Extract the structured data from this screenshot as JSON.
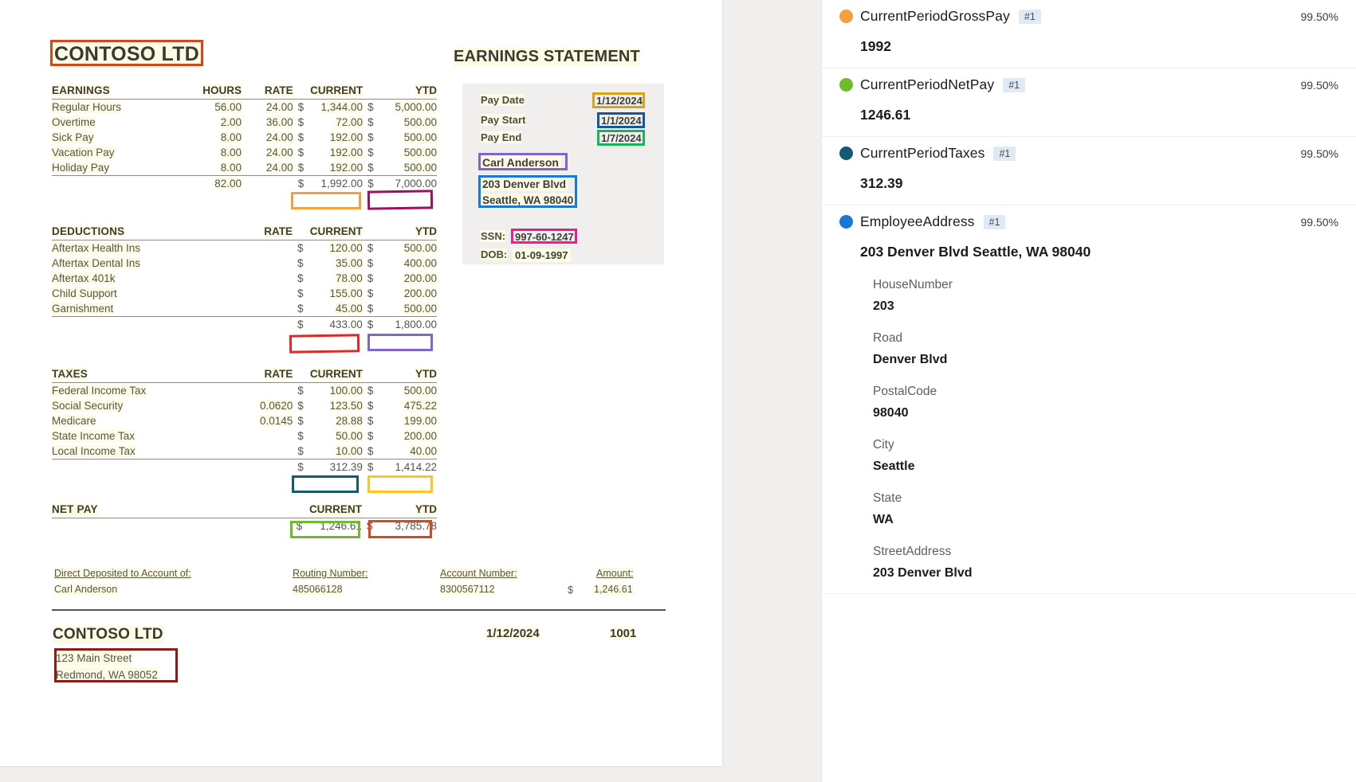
{
  "document": {
    "company_title": "CONTOSO LTD",
    "statement_title": "EARNINGS STATEMENT",
    "earnings": {
      "headers": [
        "EARNINGS",
        "HOURS",
        "RATE",
        "CURRENT",
        "YTD"
      ],
      "rows": [
        {
          "label": "Regular Hours",
          "hours": "56.00",
          "rate": "24.00",
          "current": "1,344.00",
          "ytd": "5,000.00"
        },
        {
          "label": "Overtime",
          "hours": "2.00",
          "rate": "36.00",
          "current": "72.00",
          "ytd": "500.00"
        },
        {
          "label": "Sick Pay",
          "hours": "8.00",
          "rate": "24.00",
          "current": "192.00",
          "ytd": "500.00"
        },
        {
          "label": "Vacation Pay",
          "hours": "8.00",
          "rate": "24.00",
          "current": "192.00",
          "ytd": "500.00"
        },
        {
          "label": "Holiday Pay",
          "hours": "8.00",
          "rate": "24.00",
          "current": "192.00",
          "ytd": "500.00"
        }
      ],
      "total": {
        "hours": "82.00",
        "current": "1,992.00",
        "ytd": "7,000.00"
      }
    },
    "deductions": {
      "headers": [
        "DEDUCTIONS",
        "RATE",
        "CURRENT",
        "YTD"
      ],
      "rows": [
        {
          "label": "Aftertax Health Ins",
          "rate": "",
          "current": "120.00",
          "ytd": "500.00"
        },
        {
          "label": "Aftertax Dental Ins",
          "rate": "",
          "current": "35.00",
          "ytd": "400.00"
        },
        {
          "label": "Aftertax 401k",
          "rate": "",
          "current": "78.00",
          "ytd": "200.00"
        },
        {
          "label": "Child Support",
          "rate": "",
          "current": "155.00",
          "ytd": "200.00"
        },
        {
          "label": "Garnishment",
          "rate": "",
          "current": "45.00",
          "ytd": "500.00"
        }
      ],
      "total": {
        "current": "433.00",
        "ytd": "1,800.00"
      }
    },
    "taxes": {
      "headers": [
        "TAXES",
        "RATE",
        "CURRENT",
        "YTD"
      ],
      "rows": [
        {
          "label": "Federal Income Tax",
          "rate": "",
          "current": "100.00",
          "ytd": "500.00"
        },
        {
          "label": "Social Security",
          "rate": "0.0620",
          "current": "123.50",
          "ytd": "475.22"
        },
        {
          "label": "Medicare",
          "rate": "0.0145",
          "current": "28.88",
          "ytd": "199.00"
        },
        {
          "label": "State Income Tax",
          "rate": "",
          "current": "50.00",
          "ytd": "200.00"
        },
        {
          "label": "Local Income Tax",
          "rate": "",
          "current": "10.00",
          "ytd": "40.00"
        }
      ],
      "total": {
        "current": "312.39",
        "ytd": "1,414.22"
      }
    },
    "netpay": {
      "headers": [
        "NET PAY",
        "CURRENT",
        "YTD"
      ],
      "total": {
        "current": "1,246.61",
        "ytd": "3,785.78"
      }
    },
    "statement": {
      "pay_date_label": "Pay Date",
      "pay_date_value": "1/12/2024",
      "pay_start_label": "Pay Start",
      "pay_start_value": "1/1/2024",
      "pay_end_label": "Pay End",
      "pay_end_value": "1/7/2024",
      "employee_name": "Carl Anderson",
      "address_line1": "203 Denver Blvd",
      "address_line2": "Seattle, WA 98040",
      "ssn_label": "SSN:",
      "ssn_value": "997-60-1247",
      "dob_label": "DOB:",
      "dob_value": "01-09-1997"
    },
    "deposit": {
      "account_of_label": "Direct Deposited to Account of:",
      "account_of_value": "Carl Anderson",
      "routing_label": "Routing Number:",
      "routing_value": "485066128",
      "account_label": "Account Number:",
      "account_value": "8300567112",
      "amount_label": "Amount:",
      "amount_currency": "$",
      "amount_value": "1,246.61"
    },
    "footer": {
      "company": "CONTOSO LTD",
      "date": "1/12/2024",
      "check_number": "1001",
      "address_line1": "123 Main Street",
      "address_line2": "Redmond, WA 98052"
    },
    "currency_symbol": "$"
  },
  "annotations": [
    {
      "name": "company-title",
      "color": "#d1481f"
    },
    {
      "name": "gross-current",
      "color": "#f5a03c"
    },
    {
      "name": "gross-ytd",
      "color": "#9c1160"
    },
    {
      "name": "deduct-current",
      "color": "#dc2a27"
    },
    {
      "name": "deduct-ytd",
      "color": "#8166c8"
    },
    {
      "name": "taxes-current",
      "color": "#135a72"
    },
    {
      "name": "taxes-ytd",
      "color": "#fcc51f"
    },
    {
      "name": "net-current",
      "color": "#6fbb2d"
    },
    {
      "name": "net-ytd",
      "color": "#e24618"
    },
    {
      "name": "pay-date",
      "color": "#d6a419"
    },
    {
      "name": "pay-start",
      "color": "#1257a0"
    },
    {
      "name": "pay-end",
      "color": "#17b45e"
    },
    {
      "name": "employee-name",
      "color": "#8166c8"
    },
    {
      "name": "employee-address",
      "color": "#1879d2"
    },
    {
      "name": "ssn",
      "color": "#ec1d8e"
    },
    {
      "name": "employer-address",
      "color": "#8d1c18"
    }
  ],
  "panel": {
    "fields": [
      {
        "name": "CurrentPeriodGrossPay",
        "index": "#1",
        "confidence": "99.50%",
        "color": "#f5a03c",
        "value": "1992",
        "subfields": []
      },
      {
        "name": "CurrentPeriodNetPay",
        "index": "#1",
        "confidence": "99.50%",
        "color": "#6fbb2d",
        "value": "1246.61",
        "subfields": []
      },
      {
        "name": "CurrentPeriodTaxes",
        "index": "#1",
        "confidence": "99.50%",
        "color": "#135a72",
        "value": "312.39",
        "subfields": []
      },
      {
        "name": "EmployeeAddress",
        "index": "#1",
        "confidence": "99.50%",
        "color": "#1879d2",
        "value": "203 Denver Blvd Seattle, WA 98040",
        "subfields": [
          {
            "label": "HouseNumber",
            "value": "203"
          },
          {
            "label": "Road",
            "value": "Denver Blvd"
          },
          {
            "label": "PostalCode",
            "value": "98040"
          },
          {
            "label": "City",
            "value": "Seattle"
          },
          {
            "label": "State",
            "value": "WA"
          },
          {
            "label": "StreetAddress",
            "value": "203 Denver Blvd"
          }
        ]
      }
    ]
  }
}
